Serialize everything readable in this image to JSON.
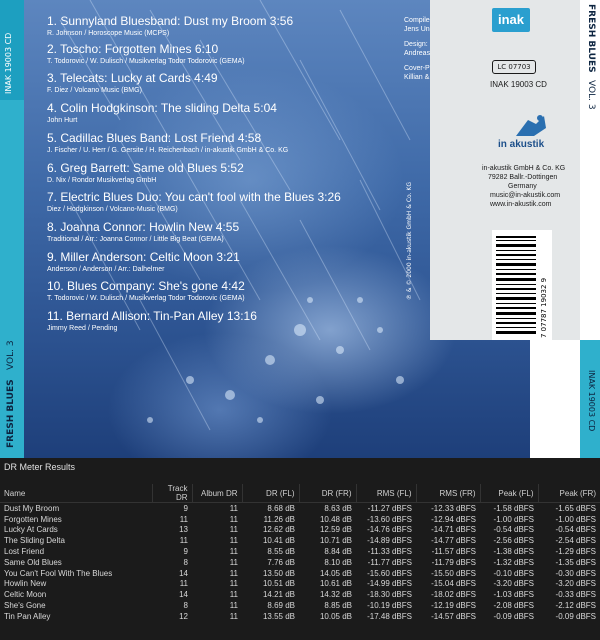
{
  "cover": {
    "spine_left_catalog": "INAK 19003 CD",
    "spine_left_title": "FRESH BLUES",
    "spine_left_vol": "VOL. 3",
    "spine_right_title": "FRESH BLUES",
    "spine_right_vol": "VOL. 3",
    "spine_right_catalog": "INAK 19003 CD",
    "copyright": "℗ & © 2000 in-akustik GmbH & Co. KG",
    "credits": [
      "Compiled by:",
      "Jens Ungelenk",
      "Design:",
      "Andreas Weindel",
      "Cover-Photo:",
      "Killian & Killian"
    ],
    "logo_text": "inak",
    "lc_code": "LC 07703",
    "catalog_no": "INAK 19003 CD",
    "label_name": "in akustik",
    "address": [
      "in-akustik GmbH & Co. KG",
      "79282 Ballr.-Dottingen",
      "Germany",
      "music@in-akustik.com",
      "www.in-akustik.com"
    ],
    "barcode_number": "7 07787 19032 9",
    "tracks": [
      {
        "title": "1. Sunnyland Bluesband: Dust my Broom   3:56",
        "credit": "R. Johnson / Horoscope Music (MCPS)"
      },
      {
        "title": "2. Toscho: Forgotten Mines   6:10",
        "credit": "T. Todorovic / W. Dulisch / Musikverlag Todor Todorovic (GEMA)"
      },
      {
        "title": "3. Telecats: Lucky at Cards   4:49",
        "credit": "F. Diez / Volcano Music (BMG)"
      },
      {
        "title": "4. Colin Hodgkinson: The sliding Delta   5:04",
        "credit": "John Hurt"
      },
      {
        "title": "5. Cadillac Blues Band: Lost Friend   4:58",
        "credit": "J. Fischer / U. Herr / G. Gersite / H. Reichenbach / in-akustik GmbH & Co. KG"
      },
      {
        "title": "6. Greg Barrett: Same old Blues   5:52",
        "credit": "D. Nix / Rondor Musikverlag GmbH"
      },
      {
        "title": "7. Electric Blues Duo: You can't fool with the Blues   3:26",
        "credit": "Diez / Hodgkinson / Volcano-Music (BMG)"
      },
      {
        "title": "8. Joanna Connor: Howlin New   4:55",
        "credit": "Traditional / Arr.: Joanna Connor / Little Big Beat (GEMA)"
      },
      {
        "title": "9. Miller Anderson: Celtic Moon   3:21",
        "credit": "Anderson / Anderson / Arr.: Dalhelmer"
      },
      {
        "title": "10. Blues Company: She's gone   4:42",
        "credit": "T. Todorovic / W. Dulisch / Musikverlag Todor Todorovic (GEMA)"
      },
      {
        "title": "11. Bernard Allison: Tin-Pan Alley   13:16",
        "credit": "Jimmy Reed / Pending"
      }
    ]
  },
  "dr_meter": {
    "window_title": "DR Meter Results",
    "columns": [
      "Name",
      "Track DR",
      "Album DR",
      "DR (FL)",
      "DR (FR)",
      "RMS (FL)",
      "RMS (FR)",
      "Peak (FL)",
      "Peak (FR)"
    ],
    "rows": [
      [
        "Dust My Broom",
        "9",
        "11",
        "8.68 dB",
        "8.63 dB",
        "-11.27 dBFS",
        "-12.33 dBFS",
        "-1.58 dBFS",
        "-1.65 dBFS"
      ],
      [
        "Forgotten Mines",
        "11",
        "11",
        "11.26 dB",
        "10.48 dB",
        "-13.60 dBFS",
        "-12.94 dBFS",
        "-1.00 dBFS",
        "-1.00 dBFS"
      ],
      [
        "Lucky At Cards",
        "13",
        "11",
        "12.62 dB",
        "12.59 dB",
        "-14.76 dBFS",
        "-14.71 dBFS",
        "-0.54 dBFS",
        "-0.54 dBFS"
      ],
      [
        "The Sliding Delta",
        "11",
        "11",
        "10.41 dB",
        "10.71 dB",
        "-14.89 dBFS",
        "-14.77 dBFS",
        "-2.56 dBFS",
        "-2.54 dBFS"
      ],
      [
        "Lost Friend",
        "9",
        "11",
        "8.55 dB",
        "8.84 dB",
        "-11.33 dBFS",
        "-11.57 dBFS",
        "-1.38 dBFS",
        "-1.29 dBFS"
      ],
      [
        "Same Old Blues",
        "8",
        "11",
        "7.76 dB",
        "8.10 dB",
        "-11.77 dBFS",
        "-11.79 dBFS",
        "-1.32 dBFS",
        "-1.35 dBFS"
      ],
      [
        "You Can't Fool With The Blues",
        "14",
        "11",
        "13.50 dB",
        "14.05 dB",
        "-15.60 dBFS",
        "-15.50 dBFS",
        "-0.10 dBFS",
        "-0.30 dBFS"
      ],
      [
        "Howlin New",
        "11",
        "11",
        "10.51 dB",
        "10.61 dB",
        "-14.99 dBFS",
        "-15.04 dBFS",
        "-3.20 dBFS",
        "-3.20 dBFS"
      ],
      [
        "Celtic Moon",
        "14",
        "11",
        "14.21 dB",
        "14.32 dB",
        "-18.30 dBFS",
        "-18.02 dBFS",
        "-1.03 dBFS",
        "-0.33 dBFS"
      ],
      [
        "She's Gone",
        "8",
        "11",
        "8.69 dB",
        "8.85 dB",
        "-10.19 dBFS",
        "-12.19 dBFS",
        "-2.08 dBFS",
        "-2.12 dBFS"
      ],
      [
        "Tin Pan Alley",
        "12",
        "11",
        "13.55 dB",
        "10.05 dB",
        "-17.48 dBFS",
        "-14.57 dBFS",
        "-0.09 dBFS",
        "-0.09 dBFS"
      ]
    ]
  },
  "colors": {
    "accent_cyan": "#2fb0cc",
    "cover_blue": "#3f6aa8",
    "table_bg": "#1b1b1b"
  }
}
